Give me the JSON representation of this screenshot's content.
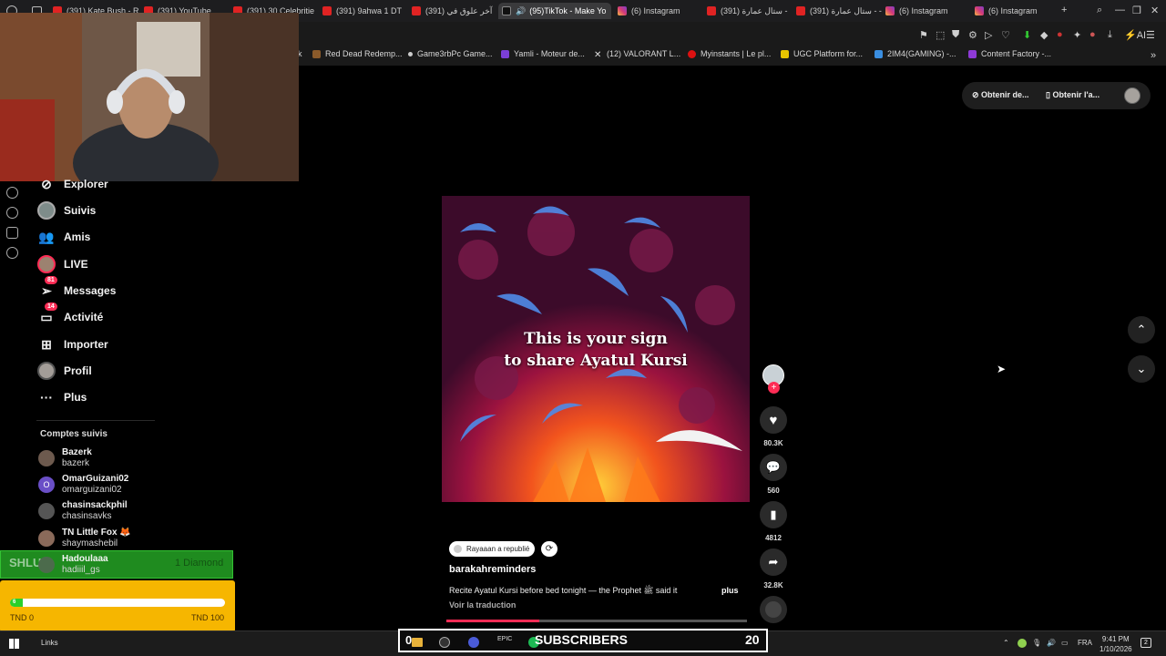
{
  "tabs": [
    {
      "label": "(391) Kate Bush - R",
      "icon": "youtube-icon"
    },
    {
      "label": "(391) YouTube",
      "icon": "youtube-icon"
    },
    {
      "label": "(391) 30 Celebritie",
      "icon": "youtube-icon"
    },
    {
      "label": "(391) 9ahwa 1 DT",
      "icon": "youtube-icon"
    },
    {
      "label": "(391) آخر علوق في",
      "icon": "youtube-icon"
    },
    {
      "label": "(95)TikTok - Make Yo",
      "icon": "tiktok-icon",
      "active": true
    },
    {
      "label": "(6) Instagram",
      "icon": "instagram-icon"
    },
    {
      "label": "(391) ستال عمارة -",
      "icon": "youtube-icon"
    },
    {
      "label": "(391) ستال عمارة - -",
      "icon": "youtube-icon"
    },
    {
      "label": "(6) Instagram",
      "icon": "instagram-icon"
    },
    {
      "label": "(6) Instagram",
      "icon": "instagram-icon"
    }
  ],
  "toolbar": {
    "ai_label": "AI"
  },
  "bookmarks": [
    {
      "label": "k"
    },
    {
      "label": "Red Dead Redemp..."
    },
    {
      "label": "Game3rbPc Game..."
    },
    {
      "label": "Yamli - Moteur de..."
    },
    {
      "label": "(12) VALORANT L..."
    },
    {
      "label": "Myinstants | Le pl..."
    },
    {
      "label": "UGC Platform for..."
    },
    {
      "label": "2IM4(GAMING) -..."
    },
    {
      "label": "Content Factory -..."
    }
  ],
  "sidebar": {
    "items": [
      {
        "label": "Explorer",
        "icon": "compass-icon"
      },
      {
        "label": "Suivis",
        "icon": "following-avatar-icon"
      },
      {
        "label": "Amis",
        "icon": "friends-icon"
      },
      {
        "label": "LIVE",
        "icon": "live-avatar-icon"
      },
      {
        "label": "Messages",
        "icon": "send-icon",
        "badge": "81"
      },
      {
        "label": "Activité",
        "icon": "activity-icon",
        "badge": "14"
      },
      {
        "label": "Importer",
        "icon": "upload-icon"
      },
      {
        "label": "Profil",
        "icon": "profile-avatar-icon"
      },
      {
        "label": "Plus",
        "icon": "more-icon"
      }
    ],
    "followed_title": "Comptes suivis",
    "accounts": [
      {
        "name": "Bazerk",
        "user": "bazerk"
      },
      {
        "name": "OmarGuizani02",
        "user": "omarguizani02",
        "initial": "O"
      },
      {
        "name": "chasinsackphil",
        "user": "chasinsavks"
      },
      {
        "name": "TN Little Fox 🦊",
        "user": "shaymashebil"
      },
      {
        "name": "Hadoulaaa",
        "user": "hadiiil_gs"
      }
    ]
  },
  "overlay": {
    "green_label": "SHLUP",
    "diamond_label": "1 Diamond",
    "progress_value": "6",
    "progress_fraction": 0.06,
    "min_label": "TND 0",
    "max_label": "TND 100"
  },
  "header": {
    "get_desktop": "Obtenir de...",
    "get_app": "Obtenir l'a..."
  },
  "video": {
    "text_line1": "This is your sign",
    "text_line2": "to share Ayatul Kursi",
    "progress_fraction": 0.31
  },
  "actions": {
    "likes": "80.3K",
    "comments": "560",
    "saves": "4812",
    "shares": "32.8K"
  },
  "caption": {
    "repost_label": "Rayaaan a republié",
    "author": "barakahreminders",
    "description": "Recite Ayatul Kursi before bed tonight — the Prophet ﷺ said it",
    "more": "plus",
    "translate": "Voir la traduction"
  },
  "taskbar": {
    "links_label": "Links",
    "subscribers_label": "SUBSCRIBERS",
    "subscribers_count": "20",
    "subscribers_left": "0",
    "lang": "FRA",
    "time": "9:41 PM",
    "date": "1/10/2026",
    "notification_count": "2"
  },
  "colors": {
    "accent": "#fe2c55",
    "green": "#1f8b1f",
    "yellow": "#f6b600"
  }
}
